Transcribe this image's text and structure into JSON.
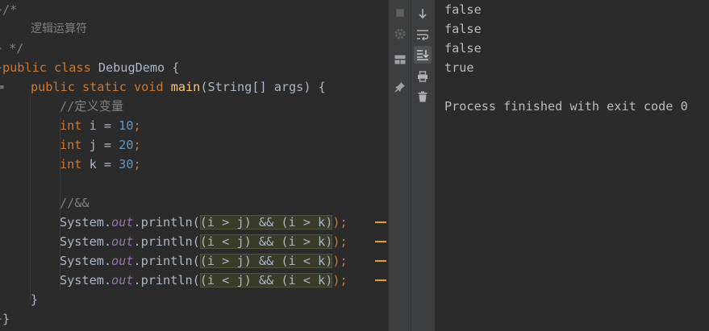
{
  "editor": {
    "comment_open": "/*",
    "comment_text": "逻辑运算符",
    "comment_close": "*/",
    "class_kw": "public class ",
    "class_name": "DebugDemo {",
    "main_kw": "public static void ",
    "main_name": "main",
    "main_args": "(String[] args) {",
    "var_comment": "//定义变量",
    "vars": [
      {
        "type": "int ",
        "name": "i",
        "eq": " = ",
        "value": "10",
        "end": ";"
      },
      {
        "type": "int ",
        "name": "j",
        "eq": " = ",
        "value": "20",
        "end": ";"
      },
      {
        "type": "int ",
        "name": "k",
        "eq": " = ",
        "value": "30",
        "end": ";"
      }
    ],
    "and_comment": "//&&",
    "prints": [
      {
        "prefix": "System.",
        "field": "out",
        "call": ".println(",
        "expr": "(i > j) && (i > k)",
        "suffix": ");"
      },
      {
        "prefix": "System.",
        "field": "out",
        "call": ".println(",
        "expr": "(i < j) && (i > k)",
        "suffix": ");"
      },
      {
        "prefix": "System.",
        "field": "out",
        "call": ".println(",
        "expr": "(i > j) && (i < k)",
        "suffix": ");"
      },
      {
        "prefix": "System.",
        "field": "out",
        "call": ".println(",
        "expr": "(i < j) && (i < k)",
        "suffix": ");"
      }
    ],
    "close_method": "}",
    "close_class": "}"
  },
  "console": {
    "lines": [
      "false",
      "false",
      "false",
      "true"
    ],
    "exit_message": "Process finished with exit code 0"
  },
  "colors": {
    "background": "#2b2b2b",
    "keyword": "#cc7832",
    "number": "#6897bb",
    "method": "#ffc66d",
    "static_field": "#9876aa",
    "comment": "#808080",
    "warning_marker": "#e0a020"
  },
  "icons": {
    "stop": "stop-icon",
    "settings": "debug-settings-icon",
    "layout": "layout-icon",
    "pin": "pin-icon",
    "scroll_down": "arrow-down-icon",
    "soft_wrap": "soft-wrap-icon",
    "scroll_end": "scroll-to-end-icon",
    "print": "print-icon",
    "trash": "trash-icon"
  }
}
